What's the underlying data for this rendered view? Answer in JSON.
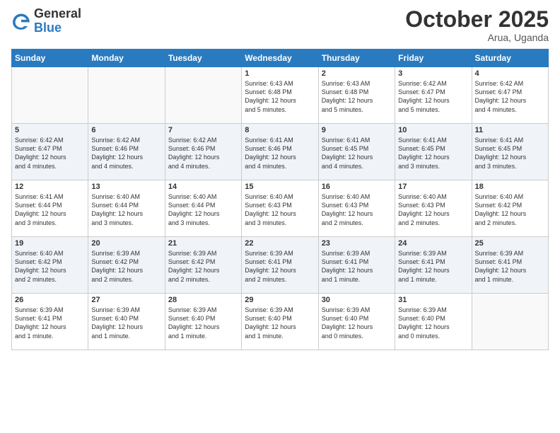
{
  "header": {
    "logo_general": "General",
    "logo_blue": "Blue",
    "month_title": "October 2025",
    "location": "Arua, Uganda"
  },
  "weekdays": [
    "Sunday",
    "Monday",
    "Tuesday",
    "Wednesday",
    "Thursday",
    "Friday",
    "Saturday"
  ],
  "weeks": [
    [
      {
        "day": "",
        "info": ""
      },
      {
        "day": "",
        "info": ""
      },
      {
        "day": "",
        "info": ""
      },
      {
        "day": "1",
        "info": "Sunrise: 6:43 AM\nSunset: 6:48 PM\nDaylight: 12 hours\nand 5 minutes."
      },
      {
        "day": "2",
        "info": "Sunrise: 6:43 AM\nSunset: 6:48 PM\nDaylight: 12 hours\nand 5 minutes."
      },
      {
        "day": "3",
        "info": "Sunrise: 6:42 AM\nSunset: 6:47 PM\nDaylight: 12 hours\nand 5 minutes."
      },
      {
        "day": "4",
        "info": "Sunrise: 6:42 AM\nSunset: 6:47 PM\nDaylight: 12 hours\nand 4 minutes."
      }
    ],
    [
      {
        "day": "5",
        "info": "Sunrise: 6:42 AM\nSunset: 6:47 PM\nDaylight: 12 hours\nand 4 minutes."
      },
      {
        "day": "6",
        "info": "Sunrise: 6:42 AM\nSunset: 6:46 PM\nDaylight: 12 hours\nand 4 minutes."
      },
      {
        "day": "7",
        "info": "Sunrise: 6:42 AM\nSunset: 6:46 PM\nDaylight: 12 hours\nand 4 minutes."
      },
      {
        "day": "8",
        "info": "Sunrise: 6:41 AM\nSunset: 6:46 PM\nDaylight: 12 hours\nand 4 minutes."
      },
      {
        "day": "9",
        "info": "Sunrise: 6:41 AM\nSunset: 6:45 PM\nDaylight: 12 hours\nand 4 minutes."
      },
      {
        "day": "10",
        "info": "Sunrise: 6:41 AM\nSunset: 6:45 PM\nDaylight: 12 hours\nand 3 minutes."
      },
      {
        "day": "11",
        "info": "Sunrise: 6:41 AM\nSunset: 6:45 PM\nDaylight: 12 hours\nand 3 minutes."
      }
    ],
    [
      {
        "day": "12",
        "info": "Sunrise: 6:41 AM\nSunset: 6:44 PM\nDaylight: 12 hours\nand 3 minutes."
      },
      {
        "day": "13",
        "info": "Sunrise: 6:40 AM\nSunset: 6:44 PM\nDaylight: 12 hours\nand 3 minutes."
      },
      {
        "day": "14",
        "info": "Sunrise: 6:40 AM\nSunset: 6:44 PM\nDaylight: 12 hours\nand 3 minutes."
      },
      {
        "day": "15",
        "info": "Sunrise: 6:40 AM\nSunset: 6:43 PM\nDaylight: 12 hours\nand 3 minutes."
      },
      {
        "day": "16",
        "info": "Sunrise: 6:40 AM\nSunset: 6:43 PM\nDaylight: 12 hours\nand 2 minutes."
      },
      {
        "day": "17",
        "info": "Sunrise: 6:40 AM\nSunset: 6:43 PM\nDaylight: 12 hours\nand 2 minutes."
      },
      {
        "day": "18",
        "info": "Sunrise: 6:40 AM\nSunset: 6:42 PM\nDaylight: 12 hours\nand 2 minutes."
      }
    ],
    [
      {
        "day": "19",
        "info": "Sunrise: 6:40 AM\nSunset: 6:42 PM\nDaylight: 12 hours\nand 2 minutes."
      },
      {
        "day": "20",
        "info": "Sunrise: 6:39 AM\nSunset: 6:42 PM\nDaylight: 12 hours\nand 2 minutes."
      },
      {
        "day": "21",
        "info": "Sunrise: 6:39 AM\nSunset: 6:42 PM\nDaylight: 12 hours\nand 2 minutes."
      },
      {
        "day": "22",
        "info": "Sunrise: 6:39 AM\nSunset: 6:41 PM\nDaylight: 12 hours\nand 2 minutes."
      },
      {
        "day": "23",
        "info": "Sunrise: 6:39 AM\nSunset: 6:41 PM\nDaylight: 12 hours\nand 1 minute."
      },
      {
        "day": "24",
        "info": "Sunrise: 6:39 AM\nSunset: 6:41 PM\nDaylight: 12 hours\nand 1 minute."
      },
      {
        "day": "25",
        "info": "Sunrise: 6:39 AM\nSunset: 6:41 PM\nDaylight: 12 hours\nand 1 minute."
      }
    ],
    [
      {
        "day": "26",
        "info": "Sunrise: 6:39 AM\nSunset: 6:41 PM\nDaylight: 12 hours\nand 1 minute."
      },
      {
        "day": "27",
        "info": "Sunrise: 6:39 AM\nSunset: 6:40 PM\nDaylight: 12 hours\nand 1 minute."
      },
      {
        "day": "28",
        "info": "Sunrise: 6:39 AM\nSunset: 6:40 PM\nDaylight: 12 hours\nand 1 minute."
      },
      {
        "day": "29",
        "info": "Sunrise: 6:39 AM\nSunset: 6:40 PM\nDaylight: 12 hours\nand 1 minute."
      },
      {
        "day": "30",
        "info": "Sunrise: 6:39 AM\nSunset: 6:40 PM\nDaylight: 12 hours\nand 0 minutes."
      },
      {
        "day": "31",
        "info": "Sunrise: 6:39 AM\nSunset: 6:40 PM\nDaylight: 12 hours\nand 0 minutes."
      },
      {
        "day": "",
        "info": ""
      }
    ]
  ]
}
